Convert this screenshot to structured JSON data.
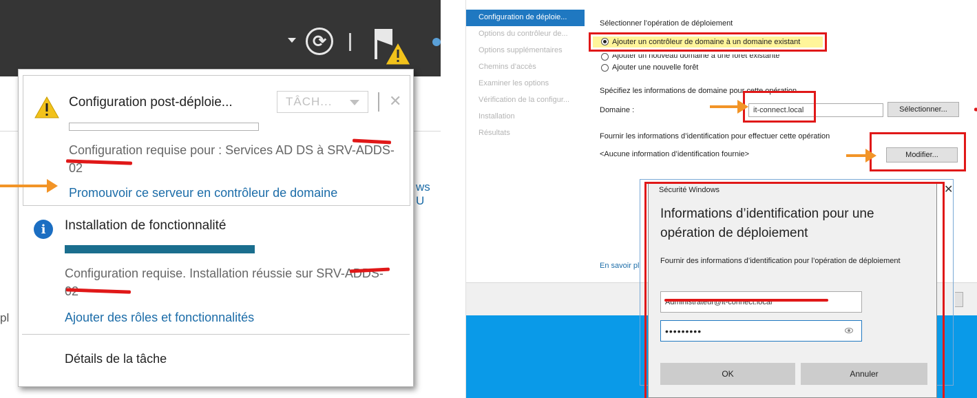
{
  "left": {
    "notifications": [
      {
        "title": "Configuration post-déploie...",
        "task_button": "TÂCH...",
        "description": "Configuration requise pour : Services AD DS à SRV-ADDS-02",
        "link": "Promouvoir ce serveur en contrôleur de domaine"
      },
      {
        "title": "Installation de fonctionnalité",
        "progress": 1.0,
        "description": "Configuration requise. Installation réussie sur SRV-ADDS-02",
        "link": "Ajouter des rôles et fonctionnalités"
      }
    ],
    "task_details": "Détails de la tâche",
    "background_text": {
      "right_fragment": "ws U",
      "left_fragment": "pl"
    },
    "icons": [
      "dropdown-caret-icon",
      "refresh-icon",
      "flag-warning-icon",
      "warning-icon",
      "info-icon",
      "close-icon"
    ]
  },
  "right": {
    "nav": [
      {
        "label": "Configuration de déploie...",
        "active": true
      },
      {
        "label": "Options du contrôleur de..."
      },
      {
        "label": "Options supplémentaires"
      },
      {
        "label": "Chemins d’accès"
      },
      {
        "label": "Examiner les options"
      },
      {
        "label": "Vérification de la configur..."
      },
      {
        "label": "Installation"
      },
      {
        "label": "Résultats"
      }
    ],
    "operation": {
      "heading": "Sélectionner l’opération de déploiement",
      "options": [
        "Ajouter un contrôleur de domaine à un domaine existant",
        "Ajouter un nouveau domaine à une forêt existante",
        "Ajouter une nouvelle forêt"
      ],
      "selected_index": 0
    },
    "domain": {
      "heading": "Spécifiez les informations de domaine pour cette opération",
      "label": "Domaine :",
      "value": "it-connect.local",
      "select_button": "Sélectionner..."
    },
    "credentials": {
      "heading": "Fournir les informations d’identification pour effectuer cette opération",
      "status": "<Aucune information d’identification fournie>",
      "modify_button": "Modifier..."
    },
    "more_link": "En savoir pl",
    "dialog": {
      "titlebar": "Sécurité Windows",
      "close": "✕",
      "heading": "Informations d’identification pour une opération de déploiement",
      "description": "Fournir des informations d’identification pour l’opération de déploiement",
      "username": "Administrateur@it-connect.local",
      "password": "•••••••••",
      "ok_button": "OK",
      "cancel_button": "Annuler"
    },
    "colors": {
      "accent": "#1f78c1",
      "highlight": "#e01818",
      "arrow": "#f29427",
      "selection": "#fff59a"
    }
  }
}
